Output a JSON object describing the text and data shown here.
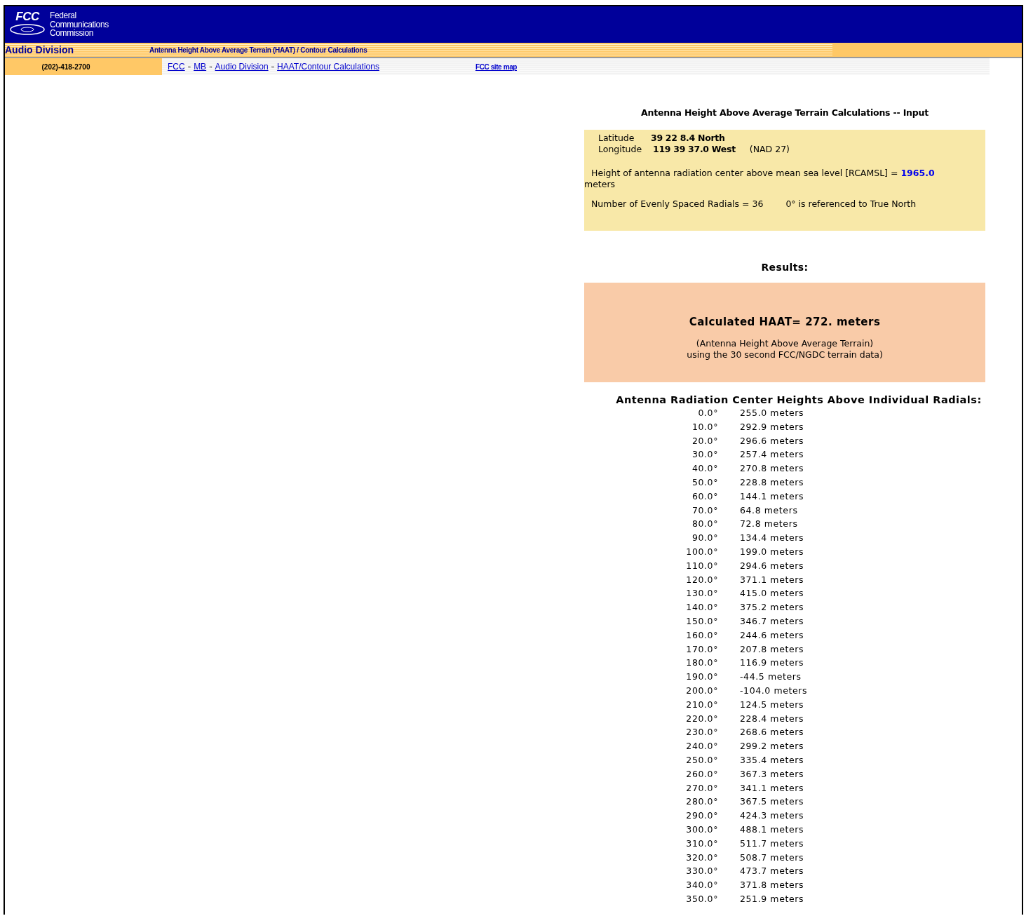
{
  "header": {
    "logo": "FCC",
    "agency": [
      "Federal",
      "Communications",
      "Commission"
    ],
    "division": "Audio Division",
    "page_title": "Antenna Height Above Average Terrain (HAAT) / Contour Calculations",
    "phone": "(202)-418-2700",
    "breadcrumbs": [
      {
        "label": "FCC"
      },
      {
        "label": "MB"
      },
      {
        "label": "Audio Division"
      },
      {
        "label": "HAAT/Contour Calculations"
      }
    ],
    "separator": "»",
    "site_map": "FCC site map"
  },
  "input": {
    "title": "Antenna Height Above Average Terrain Calculations -- Input",
    "latitude_label": "Latitude",
    "latitude": "39 22 8.4 North",
    "longitude_label": "Longitude",
    "longitude": "119 39 37.0 West",
    "datum": "(NAD 27)",
    "height_text": "Height of antenna radiation center above mean sea level [RCAMSL] =",
    "height_value": "1965.0",
    "height_unit": "meters",
    "radials_text": "Number of Evenly Spaced Radials = 36",
    "north_note": "0° is referenced to True North"
  },
  "results": {
    "heading": "Results:",
    "haat": "Calculated HAAT= 272. meters",
    "note": [
      "(Antenna Height Above Average Terrain)",
      "using the 30 second FCC/NGDC terrain data)"
    ]
  },
  "radials": {
    "heading": "Antenna Radiation Center Heights Above Individual Radials:",
    "rows": [
      {
        "angle": "0.0°",
        "height": "255.0 meters"
      },
      {
        "angle": "10.0°",
        "height": "292.9 meters"
      },
      {
        "angle": "20.0°",
        "height": "296.6 meters"
      },
      {
        "angle": "30.0°",
        "height": "257.4 meters"
      },
      {
        "angle": "40.0°",
        "height": "270.8 meters"
      },
      {
        "angle": "50.0°",
        "height": "228.8 meters"
      },
      {
        "angle": "60.0°",
        "height": "144.1 meters"
      },
      {
        "angle": "70.0°",
        "height": "64.8 meters"
      },
      {
        "angle": "80.0°",
        "height": "72.8 meters"
      },
      {
        "angle": "90.0°",
        "height": "134.4 meters"
      },
      {
        "angle": "100.0°",
        "height": "199.0 meters"
      },
      {
        "angle": "110.0°",
        "height": "294.6 meters"
      },
      {
        "angle": "120.0°",
        "height": "371.1 meters"
      },
      {
        "angle": "130.0°",
        "height": "415.0 meters"
      },
      {
        "angle": "140.0°",
        "height": "375.2 meters"
      },
      {
        "angle": "150.0°",
        "height": "346.7 meters"
      },
      {
        "angle": "160.0°",
        "height": "244.6 meters"
      },
      {
        "angle": "170.0°",
        "height": "207.8 meters"
      },
      {
        "angle": "180.0°",
        "height": "116.9 meters"
      },
      {
        "angle": "190.0°",
        "height": "-44.5 meters"
      },
      {
        "angle": "200.0°",
        "height": "-104.0 meters"
      },
      {
        "angle": "210.0°",
        "height": "124.5 meters"
      },
      {
        "angle": "220.0°",
        "height": "228.4 meters"
      },
      {
        "angle": "230.0°",
        "height": "268.6 meters"
      },
      {
        "angle": "240.0°",
        "height": "299.2 meters"
      },
      {
        "angle": "250.0°",
        "height": "335.4 meters"
      },
      {
        "angle": "260.0°",
        "height": "367.3 meters"
      },
      {
        "angle": "270.0°",
        "height": "341.1 meters"
      },
      {
        "angle": "280.0°",
        "height": "367.5 meters"
      },
      {
        "angle": "290.0°",
        "height": "424.3 meters"
      },
      {
        "angle": "300.0°",
        "height": "488.1 meters"
      },
      {
        "angle": "310.0°",
        "height": "511.7 meters"
      },
      {
        "angle": "320.0°",
        "height": "508.7 meters"
      },
      {
        "angle": "330.0°",
        "height": "473.7 meters"
      },
      {
        "angle": "340.0°",
        "height": "371.8 meters"
      },
      {
        "angle": "350.0°",
        "height": "251.9 meters"
      }
    ]
  }
}
